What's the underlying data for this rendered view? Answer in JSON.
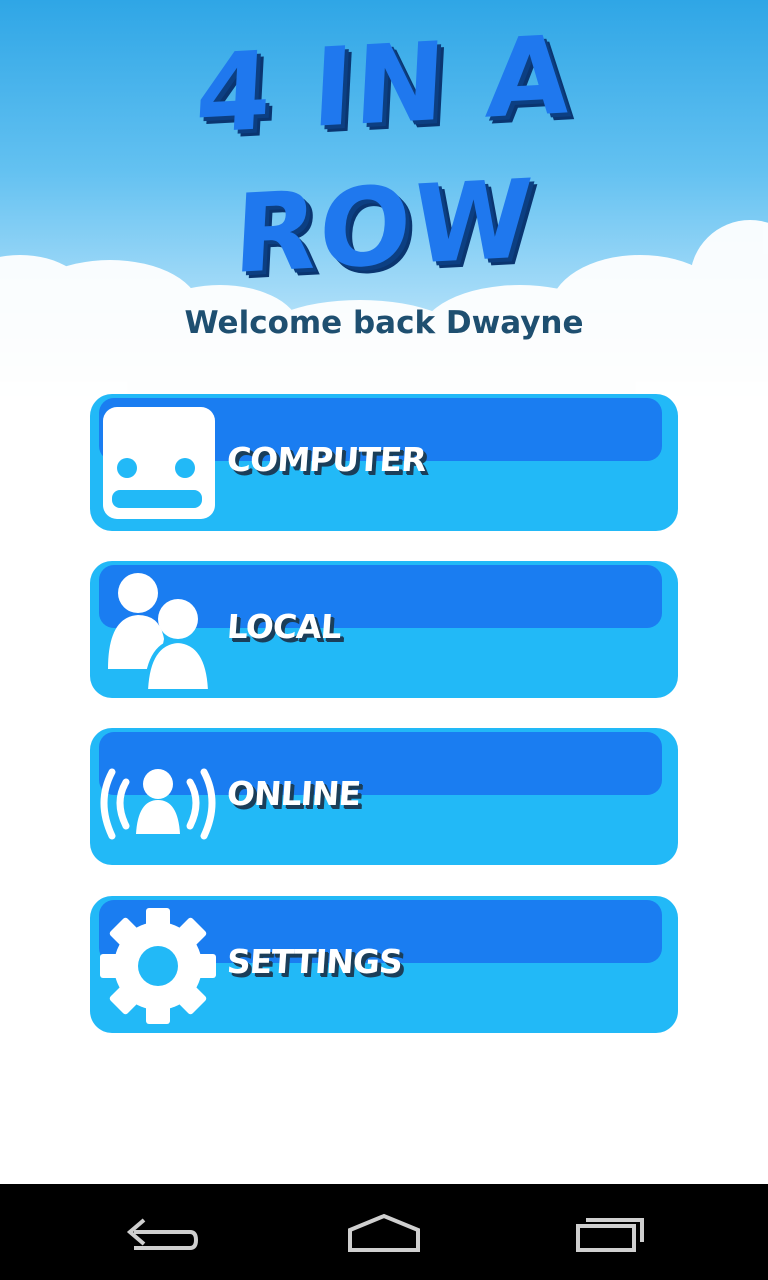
{
  "app": {
    "title_line1": "4 IN A",
    "title_line2": "ROW",
    "welcome": "Welcome back Dwayne"
  },
  "menu": [
    {
      "label": "COMPUTER",
      "icon": "robot-face-icon"
    },
    {
      "label": "LOCAL",
      "icon": "two-users-icon"
    },
    {
      "label": "ONLINE",
      "icon": "user-broadcast-icon"
    },
    {
      "label": "SETTINGS",
      "icon": "gear-icon"
    }
  ],
  "navbar": {
    "items": [
      "back-icon",
      "home-icon",
      "recent-apps-icon"
    ]
  },
  "colors": {
    "title": "#1f78ee",
    "button": "#22b9f7",
    "button_highlight": "#1a7df1",
    "welcome_text": "#1e4f70"
  }
}
